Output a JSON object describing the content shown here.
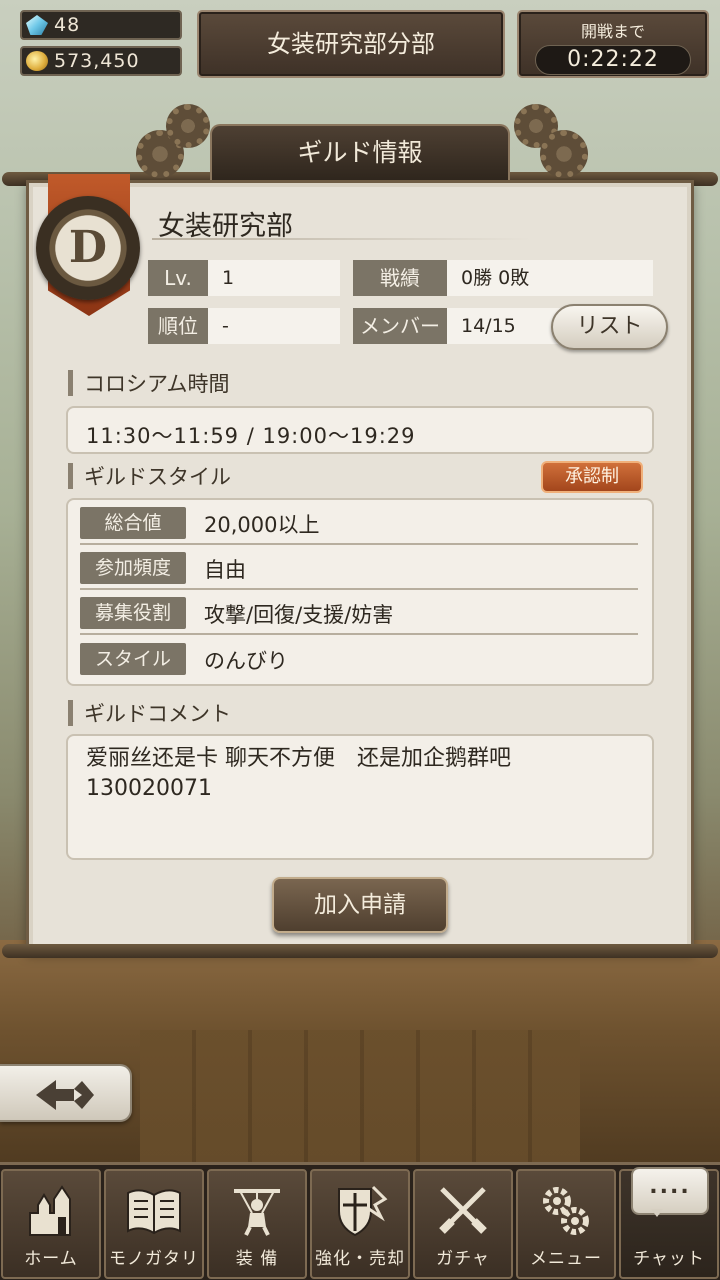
{
  "currency": {
    "gems": "48",
    "coins": "573,450",
    "gem_icon": "crystal-icon",
    "coin_icon": "coin-stack-icon"
  },
  "header": {
    "guild_title": "女装研究部分部",
    "battle_label": "開戦まで",
    "battle_timer": "0:22:22"
  },
  "panel": {
    "title": "ギルド情報",
    "rank": "D",
    "guild_name": "女装研究部",
    "stats": {
      "level_label": "Lv.",
      "level_value": "1",
      "record_label": "戦績",
      "record_value": "0勝 0敗",
      "rank_label": "順位",
      "rank_value": "-",
      "members_label": "メンバー",
      "members_value": "14/15",
      "list_button": "リスト"
    },
    "colosseum": {
      "title": "コロシアム時間",
      "time": "11:30〜11:59 / 19:00〜19:29"
    },
    "style": {
      "title": "ギルドスタイル",
      "badge": "承認制",
      "rows": [
        {
          "label": "総合値",
          "value": "20,000以上"
        },
        {
          "label": "参加頻度",
          "value": "自由"
        },
        {
          "label": "募集役割",
          "value": "攻撃/回復/支援/妨害"
        },
        {
          "label": "スタイル",
          "value": "のんびり"
        }
      ]
    },
    "comment": {
      "title": "ギルドコメント",
      "text": "爱丽丝还是卡 聊天不方便　还是加企鹅群吧\n130020071"
    },
    "join_button": "加入申請"
  },
  "back_icon": "back-arrow-icon",
  "nav": [
    {
      "label": "ホーム",
      "icon": "castle-icon"
    },
    {
      "label": "モノガタリ",
      "icon": "book-icon"
    },
    {
      "label": "装 備",
      "icon": "puppet-icon"
    },
    {
      "label": "強化・売却",
      "icon": "shield-icon"
    },
    {
      "label": "ガチャ",
      "icon": "crossed-swords-icon"
    },
    {
      "label": "メニュー",
      "icon": "gears-icon"
    },
    {
      "label": "チャット",
      "icon": "chat-bubble-icon",
      "bubble": "...."
    }
  ],
  "colors": {
    "panel_bg": "#e7e2d8",
    "label_bg": "#7b7466",
    "accent_badge": "#b8522a",
    "dark_wood": "#3e3127"
  }
}
